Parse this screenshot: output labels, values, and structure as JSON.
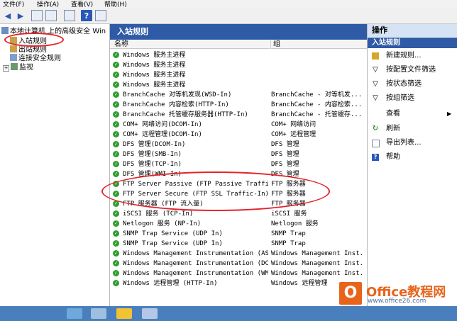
{
  "menu": [
    "文件(F)",
    "操作(A)",
    "查看(V)",
    "帮助(H)"
  ],
  "toolbar_icons": [
    "back-icon",
    "forward-icon",
    "up-icon",
    "show-tree-icon",
    "export-icon",
    "help-icon",
    "console-icon"
  ],
  "tree": {
    "root": "本地计算机 上的高级安全 Win",
    "items": [
      "入站规则",
      "出站规则",
      "连接安全规则",
      "监视"
    ]
  },
  "center": {
    "title": "入站规则",
    "col_name": "名称",
    "col_group": "组",
    "rows": [
      {
        "name": "Windows 服务主进程",
        "group": ""
      },
      {
        "name": "Windows 服务主进程",
        "group": ""
      },
      {
        "name": "Windows 服务主进程",
        "group": ""
      },
      {
        "name": "Windows 服务主进程",
        "group": ""
      },
      {
        "name": "BranchCache 对等机发现(WSD-In)",
        "group": "BranchCache - 对等机发..."
      },
      {
        "name": "BranchCache 内容检索(HTTP-In)",
        "group": "BranchCache - 内容检索..."
      },
      {
        "name": "BranchCache 托管缓存服务器(HTTP-In)",
        "group": "BranchCache - 托管缓存..."
      },
      {
        "name": "COM+ 网络访问(DCOM-In)",
        "group": "COM+ 网络访问"
      },
      {
        "name": "COM+ 远程管理(DCOM-In)",
        "group": "COM+ 远程管理"
      },
      {
        "name": "DFS 管理(DCOM-In)",
        "group": "DFS 管理"
      },
      {
        "name": "DFS 管理(SMB-In)",
        "group": "DFS 管理"
      },
      {
        "name": "DFS 管理(TCP-In)",
        "group": "DFS 管理"
      },
      {
        "name": "DFS 管理(WMI-In)",
        "group": "DFS 管理"
      },
      {
        "name": "FTP Server Passive (FTP Passive Traffi...",
        "group": "FTP 服务器"
      },
      {
        "name": "FTP Server Secure (FTP SSL Traffic-In)",
        "group": "FTP 服务器"
      },
      {
        "name": "FTP 服务器 (FTP 流入量)",
        "group": "FTP 服务器"
      },
      {
        "name": "iSCSI 服务 (TCP-In)",
        "group": "iSCSI 服务"
      },
      {
        "name": "Netlogon 服务 (NP-In)",
        "group": "Netlogon 服务"
      },
      {
        "name": "SNMP Trap Service (UDP In)",
        "group": "SNMP Trap"
      },
      {
        "name": "SNMP Trap Service (UDP In)",
        "group": "SNMP Trap"
      },
      {
        "name": "Windows Management Instrumentation (AS...",
        "group": "Windows Management Inst..."
      },
      {
        "name": "Windows Management Instrumentation (DC...",
        "group": "Windows Management Inst..."
      },
      {
        "name": "Windows Management Instrumentation (WM...",
        "group": "Windows Management Inst..."
      },
      {
        "name": "Windows 远程管理 (HTTP-In)",
        "group": "Windows 远程管理"
      }
    ]
  },
  "actions": {
    "title": "操作",
    "subtitle": "入站规则",
    "items": [
      {
        "label": "新建规则...",
        "icon": "new-rule-icon"
      },
      {
        "label": "按配置文件筛选",
        "icon": "filter-icon"
      },
      {
        "label": "按状态筛选",
        "icon": "filter-icon"
      },
      {
        "label": "按组筛选",
        "icon": "filter-icon"
      },
      {
        "label": "查看",
        "icon": ""
      },
      {
        "label": "刷新",
        "icon": "refresh-icon"
      },
      {
        "label": "导出列表...",
        "icon": "export-icon"
      },
      {
        "label": "帮助",
        "icon": "help-icon"
      }
    ]
  },
  "watermark": {
    "title": "Office教程网",
    "url": "www.office26.com"
  },
  "colors": {
    "panel_blue": "#2f5aa6",
    "check_green": "#2f9e2f",
    "annotation_red": "#e3242b",
    "watermark_orange": "#e8641b"
  }
}
